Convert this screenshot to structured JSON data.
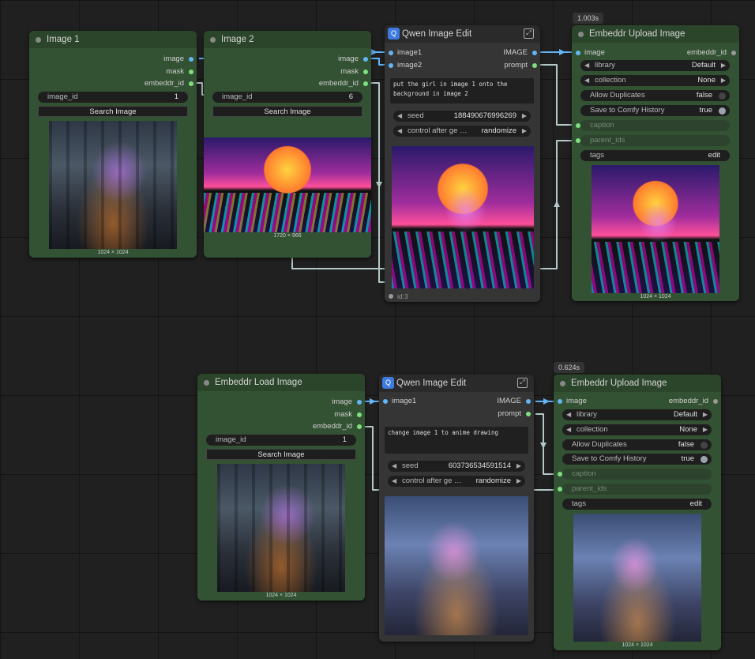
{
  "timings": {
    "top_upload": "1.003s",
    "bottom_upload": "0.624s"
  },
  "colors": {
    "node_green": "#335233",
    "node_gray": "#353535",
    "wire": "#b4c8c8",
    "image_link": "#64b5f6",
    "id_link": "#7ee07e"
  },
  "nodes": {
    "image1": {
      "title": "Image 1",
      "outputs": [
        "image",
        "mask",
        "embeddr_id"
      ],
      "image_id_label": "image_id",
      "image_id_value": "1",
      "search_button": "Search Image",
      "size_caption": "1024 × 1024"
    },
    "image2": {
      "title": "Image 2",
      "outputs": [
        "image",
        "mask",
        "embeddr_id"
      ],
      "image_id_label": "image_id",
      "image_id_value": "6",
      "search_button": "Search Image",
      "size_caption": "1720 × 966"
    },
    "qwen1": {
      "title": "Qwen Image Edit",
      "inputs": [
        "image1",
        "image2"
      ],
      "outputs": [
        "IMAGE",
        "prompt"
      ],
      "prompt_text": "put the girl in image 1 onto the background in image 2",
      "seed_label": "seed",
      "seed_value": "188490676996269",
      "control_label": "control after ge …",
      "control_value": "randomize",
      "node_id": "id:3"
    },
    "upload1": {
      "title": "Embeddr Upload Image",
      "input": "image",
      "output": "embeddr_id",
      "library_label": "library",
      "library_value": "Default",
      "collection_label": "collection",
      "collection_value": "None",
      "dupes_label": "Allow Duplicates",
      "dupes_value": "false",
      "history_label": "Save to Comfy History",
      "history_value": "true",
      "caption_label": "caption",
      "parent_label": "parent_ids",
      "tags_label": "tags",
      "tags_value": "edit",
      "size_caption": "1024 × 1024"
    },
    "load": {
      "title": "Embeddr Load Image",
      "outputs": [
        "image",
        "mask",
        "embeddr_id"
      ],
      "image_id_label": "image_id",
      "image_id_value": "1",
      "search_button": "Search Image",
      "size_caption": "1024 × 1024"
    },
    "qwen2": {
      "title": "Qwen Image Edit",
      "inputs": [
        "image1"
      ],
      "outputs": [
        "IMAGE",
        "prompt"
      ],
      "prompt_text": "change image 1 to anime drawing",
      "seed_label": "seed",
      "seed_value": "603736534591514",
      "control_label": "control after ge …",
      "control_value": "randomize"
    },
    "upload2": {
      "title": "Embeddr Upload Image",
      "input": "image",
      "output": "embeddr_id",
      "library_label": "library",
      "library_value": "Default",
      "collection_label": "collection",
      "collection_value": "None",
      "dupes_label": "Allow Duplicates",
      "dupes_value": "false",
      "history_label": "Save to Comfy History",
      "history_value": "true",
      "caption_label": "caption",
      "parent_label": "parent_ids",
      "tags_label": "tags",
      "tags_value": "edit",
      "size_caption": "1024 × 1024"
    }
  }
}
